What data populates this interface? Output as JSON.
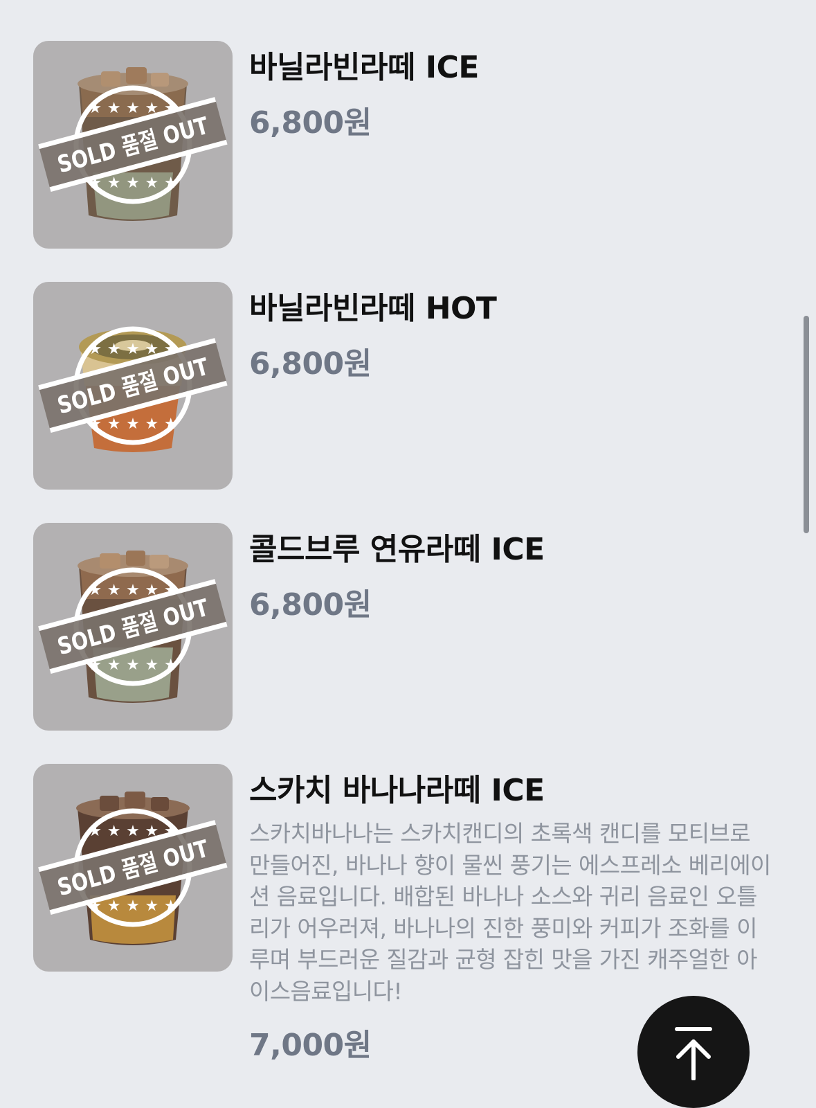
{
  "menu_items": [
    {
      "name": "바닐라빈라떼 ICE",
      "price": "6,800원",
      "badge": "SOLD 품절 OUT",
      "drink": "iced-latte",
      "status": "sold-out"
    },
    {
      "name": "바닐라빈라떼 HOT",
      "price": "6,800원",
      "badge": "SOLD 품절 OUT",
      "drink": "hot-latte",
      "status": "sold-out"
    },
    {
      "name": "콜드브루 연유라떼 ICE",
      "price": "6,800원",
      "badge": "SOLD 품절 OUT",
      "drink": "iced-latte",
      "status": "sold-out"
    },
    {
      "name": "스카치 바나나라떼 ICE",
      "description": "스카치바나나는 스카치캔디의 초록색 캔디를 모티브로 만들어진, 바나나 향이 물씬 풍기는 에스프레소 베리에이션 음료입니다. 배합된 바나나 소스와 귀리 음료인 오틀리가 어우러져, 바나나의 진한 풍미와 커피가 조화를 이루며 부드러운 질감과 균형 잡힌 맛을 가진 캐주얼한 아이스음료입니다!",
      "price": "7,000원",
      "badge": "SOLD 품절 OUT",
      "drink": "iced-coffee",
      "status": "sold-out"
    }
  ],
  "scroll_top_button": {
    "icon": "arrow-up-to-top-icon"
  },
  "colors": {
    "background": "#e9ebef",
    "thumbnail": "#b3b1b2",
    "name": "#111111",
    "price": "#6f7786",
    "description": "#8e949e",
    "button": "#151515"
  }
}
